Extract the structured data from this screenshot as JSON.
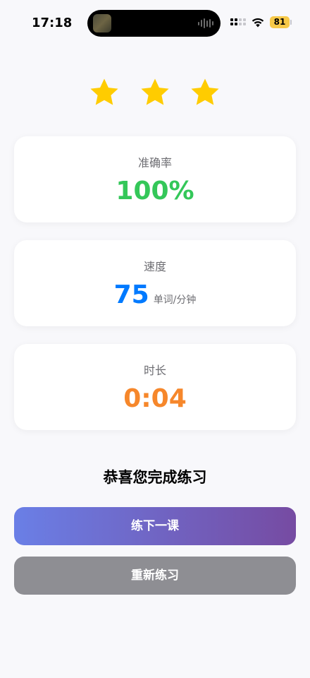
{
  "status_bar": {
    "time": "17:18",
    "battery": "81",
    "battery_color": "#f7c948"
  },
  "rating": {
    "stars_filled": 3,
    "stars_total": 3,
    "star_color": "#ffcc00"
  },
  "stats": {
    "accuracy": {
      "label": "准确率",
      "value": "100%",
      "color": "#34c759"
    },
    "speed": {
      "label": "速度",
      "value": "75",
      "unit": "单词/分钟",
      "color": "#007aff"
    },
    "duration": {
      "label": "时长",
      "value": "0:04",
      "color": "#f6872b"
    }
  },
  "message": {
    "congrats": "恭喜您完成练习"
  },
  "actions": {
    "next_lesson_label": "练下一课",
    "retry_label": "重新练习",
    "next_gradient": [
      "#6a7fe6",
      "#764ba2"
    ],
    "retry_color": "#8e8e93"
  }
}
